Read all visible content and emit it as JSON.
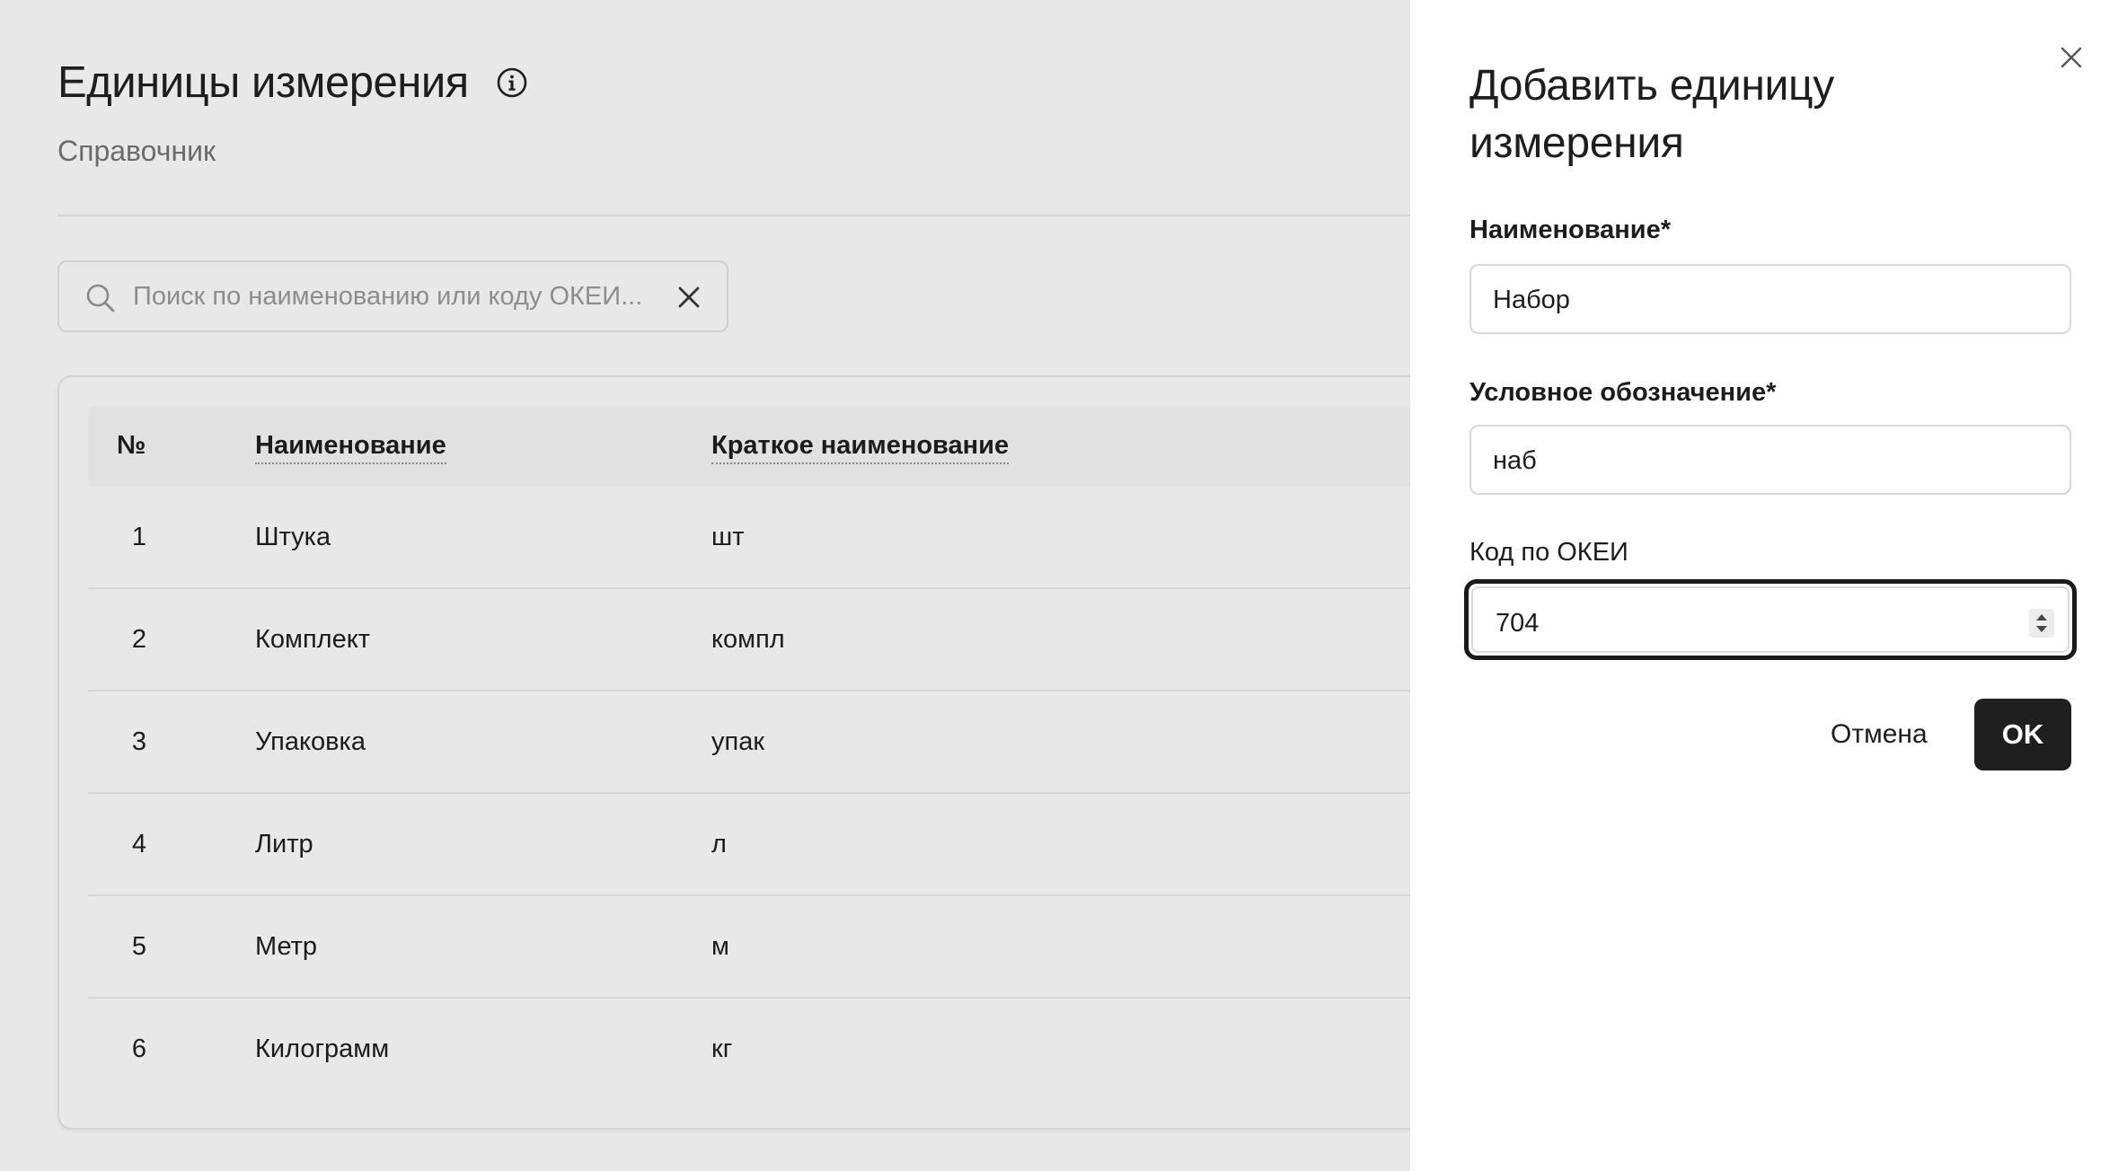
{
  "page": {
    "title": "Единицы измерения",
    "subtitle": "Справочник",
    "search": {
      "placeholder": "Поиск по наименованию или коду ОКЕИ..."
    }
  },
  "table": {
    "columns": {
      "num": "№",
      "name": "Наименование",
      "short": "Краткое наименование"
    },
    "rows": [
      {
        "num": "1",
        "name": "Штука",
        "short": "шт"
      },
      {
        "num": "2",
        "name": "Комплект",
        "short": "компл"
      },
      {
        "num": "3",
        "name": "Упаковка",
        "short": "упак"
      },
      {
        "num": "4",
        "name": "Литр",
        "short": "л"
      },
      {
        "num": "5",
        "name": "Метр",
        "short": "м"
      },
      {
        "num": "6",
        "name": "Килограмм",
        "short": "кг"
      }
    ]
  },
  "drawer": {
    "title": "Добавить единицу измерения",
    "name_label": "Наименование*",
    "name_value": "Набор",
    "symbol_label": "Условное обозначение*",
    "symbol_value": "наб",
    "okei_label": "Код по ОКЕИ",
    "okei_value": "704",
    "cancel_label": "Отмена",
    "ok_label": "OK"
  },
  "icons": [
    "info-icon",
    "search-icon",
    "clear-icon",
    "close-icon",
    "spinner-icon"
  ],
  "colors": {
    "primary_button": "#1f1f1f",
    "background": "#e8e8e8",
    "drawer": "#ffffff"
  }
}
